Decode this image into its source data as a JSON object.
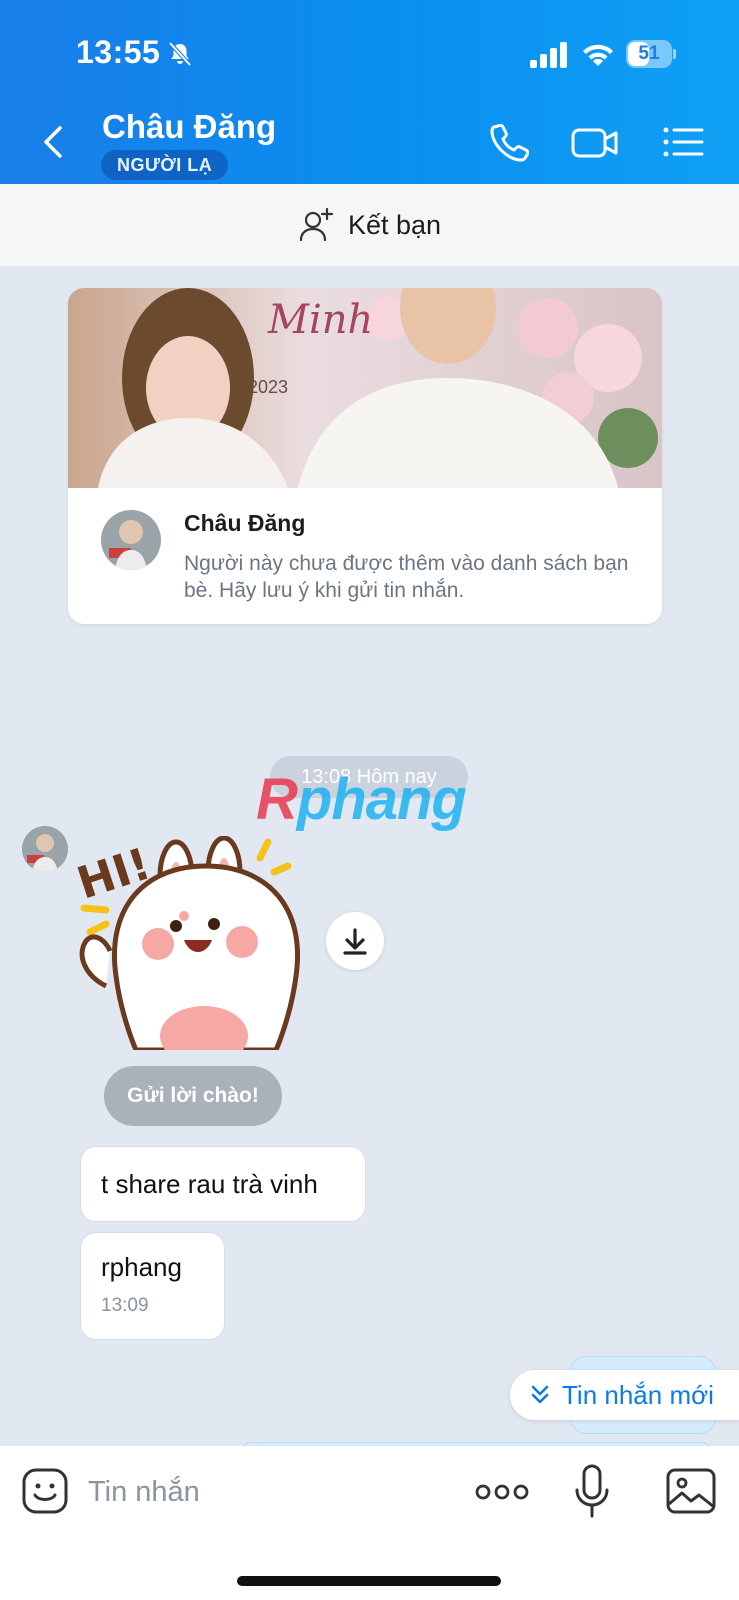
{
  "status_bar": {
    "time": "13:55",
    "battery": "51",
    "battery_level": 0.51
  },
  "header": {
    "contact_name": "Châu Đăng",
    "badge": "NGƯỜI LẠ",
    "icons": [
      "back-icon",
      "phone-icon",
      "video-icon",
      "list-icon"
    ]
  },
  "add_friend": {
    "label": "Kết bạn",
    "icon": "add-user-icon"
  },
  "profile_card": {
    "name": "Châu Đăng",
    "note": "Người này chưa được thêm vào danh sách bạn bè. Hãy lưu ý khi gửi tin nhắn."
  },
  "conversation": {
    "time_divider": "13:08 Hôm nay",
    "watermark": {
      "part1": "R",
      "part2": "phang"
    },
    "greet_button": "Gửi lời chào!",
    "messages": [
      {
        "text": "t share rau trà vinh"
      },
      {
        "text": "rphang",
        "time": "13:09"
      }
    ],
    "new_messages_label": "Tin nhắn mới"
  },
  "input_bar": {
    "placeholder": "Tin nhắn"
  },
  "colors": {
    "header_blue": "#0a8ef0",
    "accent": "#0a7bea",
    "chat_bg": "#e2e8f1"
  }
}
